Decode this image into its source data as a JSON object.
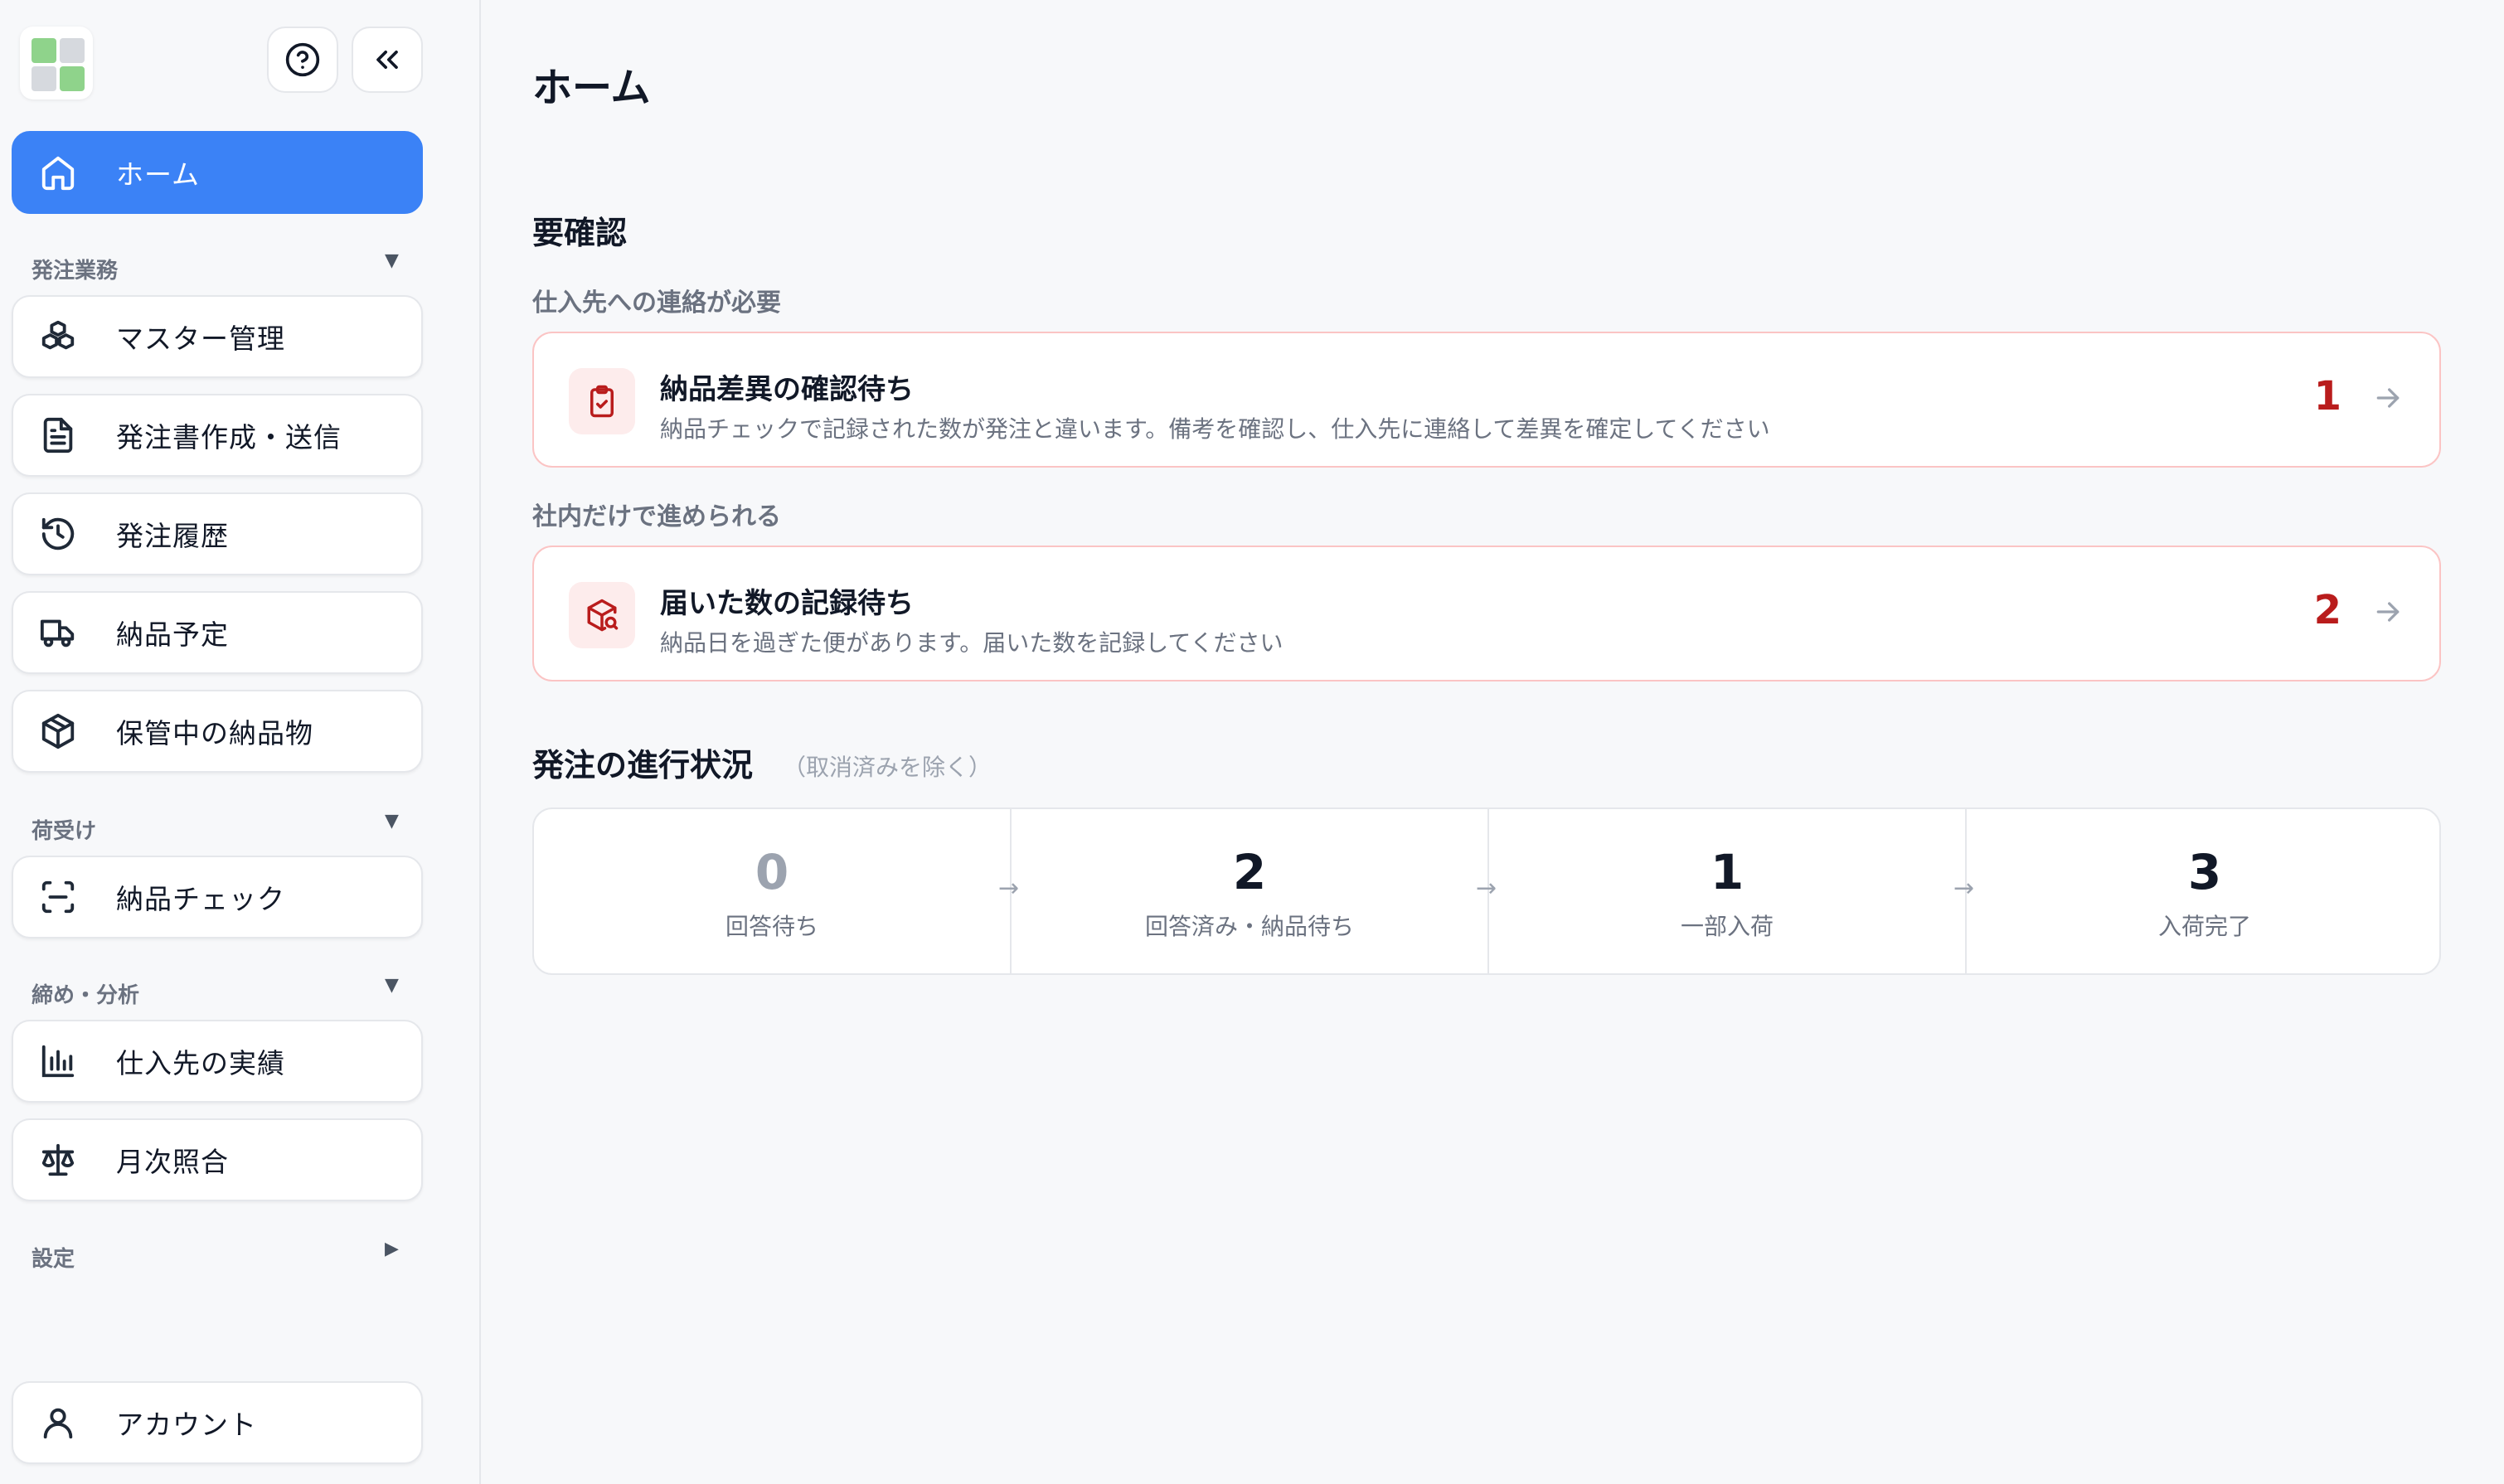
{
  "header": {
    "title": "ホーム"
  },
  "colors": {
    "accent": "#3b82f6",
    "alert": "#b91c1c",
    "logo": [
      "#8fd38b",
      "#d6d9de",
      "#d6d9de",
      "#8fd38b"
    ]
  },
  "sidebar": {
    "help_icon": "help-circle-icon",
    "collapse_icon": "double-chevron-left-icon",
    "home": {
      "label": "ホーム",
      "icon": "home-icon"
    },
    "sections": [
      {
        "label": "発注業務",
        "caret": "▼",
        "items": [
          {
            "label": "マスター管理",
            "icon": "boxes-icon"
          },
          {
            "label": "発注書作成・送信",
            "icon": "document-icon"
          },
          {
            "label": "発注履歴",
            "icon": "history-icon"
          },
          {
            "label": "納品予定",
            "icon": "truck-icon"
          },
          {
            "label": "保管中の納品物",
            "icon": "package-icon"
          }
        ]
      },
      {
        "label": "荷受け",
        "caret": "▼",
        "items": [
          {
            "label": "納品チェック",
            "icon": "scan-icon"
          }
        ]
      },
      {
        "label": "締め・分析",
        "caret": "▼",
        "items": [
          {
            "label": "仕入先の実績",
            "icon": "bar-chart-icon"
          },
          {
            "label": "月次照合",
            "icon": "scale-icon"
          }
        ]
      },
      {
        "label": "設定",
        "caret": "▶",
        "items": []
      }
    ],
    "account": {
      "label": "アカウント",
      "icon": "user-icon"
    }
  },
  "main": {
    "attention": {
      "heading": "要確認",
      "groups": [
        {
          "label": "仕入先への連絡が必要",
          "card": {
            "icon": "clipboard-check-icon",
            "title": "納品差異の確認待ち",
            "description": "納品チェックで記録された数が発注と違います。備考を確認し、仕入先に連絡して差異を確定してください",
            "count": "1"
          }
        },
        {
          "label": "社内だけで進められる",
          "card": {
            "icon": "package-search-icon",
            "title": "届いた数の記録待ち",
            "description": "納品日を過ぎた便があります。届いた数を記録してください",
            "count": "2"
          }
        }
      ]
    },
    "progress": {
      "heading": "発注の進行状況",
      "note": "（取消済みを除く）",
      "arrow": "→",
      "stages": [
        {
          "count": "0",
          "label": "回答待ち"
        },
        {
          "count": "2",
          "label": "回答済み・納品待ち"
        },
        {
          "count": "1",
          "label": "一部入荷"
        },
        {
          "count": "3",
          "label": "入荷完了"
        }
      ]
    }
  }
}
